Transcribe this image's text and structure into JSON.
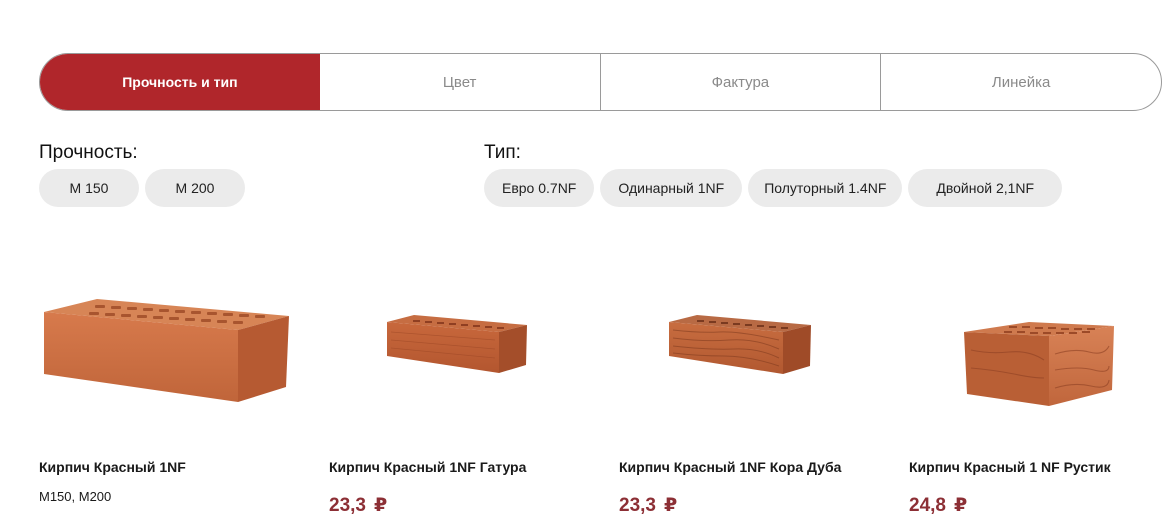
{
  "tabs": [
    {
      "label": "Прочность и тип",
      "active": true
    },
    {
      "label": "Цвет",
      "active": false
    },
    {
      "label": "Фактура",
      "active": false
    },
    {
      "label": "Линейка",
      "active": false
    }
  ],
  "strength": {
    "title": "Прочность:",
    "options": [
      "М 150",
      "М 200"
    ]
  },
  "type": {
    "title": "Тип:",
    "options": [
      "Евро 0.7NF",
      "Одинарный 1NF",
      "Полуторный 1.4NF",
      "Двойной 2,1NF"
    ]
  },
  "products": [
    {
      "name": "Кирпич Красный 1NF",
      "grades": "М150, М200",
      "price": "",
      "currency": "",
      "icon": "brick-image"
    },
    {
      "name": "Кирпич Красный 1NF Гатура",
      "grades": "",
      "price": "23,3",
      "currency": "₽",
      "icon": "brick-image"
    },
    {
      "name": "Кирпич Красный 1NF Кора Дуба",
      "grades": "",
      "price": "23,3",
      "currency": "₽",
      "icon": "brick-image"
    },
    {
      "name": "Кирпич Красный 1 NF Рустик",
      "grades": "",
      "price": "24,8",
      "currency": "₽",
      "icon": "brick-image"
    }
  ],
  "colors": {
    "accent": "#b0262b",
    "price": "#8c2f35",
    "chip": "#ebebeb"
  }
}
